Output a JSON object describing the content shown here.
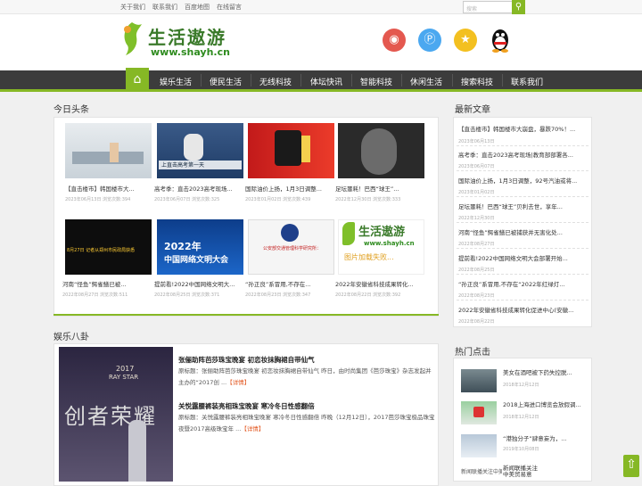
{
  "topbar": {
    "links": [
      "关于我们",
      "联系我们",
      "百度地图",
      "在线留言"
    ],
    "search_placeholder": "搜索"
  },
  "logo": {
    "title": "生活遨游",
    "url": "www.shayh.cn"
  },
  "nav": {
    "items": [
      "娱乐生活",
      "便民生活",
      "无线科技",
      "体坛快讯",
      "智能科技",
      "休闲生活",
      "搜索科技",
      "联系我们"
    ]
  },
  "headlines": {
    "title": "今日头条",
    "cards": [
      {
        "title": "【直击楼市】韩国楼市大...",
        "date": "2023年06月13日",
        "views": "浏览次数:394"
      },
      {
        "title": "高考季：直击2023高考现场...",
        "date": "2023年06月07日",
        "views": "浏览次数:325"
      },
      {
        "title": "国际油价上扬，1月3日调整...",
        "date": "2023年01月02日",
        "views": "浏览次数:439"
      },
      {
        "title": "足坛噩耗！巴西“球王”...",
        "date": "2022年12月30日",
        "views": "浏览次数:333"
      },
      {
        "title": "河南“怪鱼”鳄雀鳝已被...",
        "date": "2022年08月27日",
        "views": "浏览次数:511"
      },
      {
        "title": "提前看!2022中国网络文明大...",
        "date": "2022年08月25日",
        "views": "浏览次数:371"
      },
      {
        "title": "“孙正良”系冒用,不存在...",
        "date": "2022年08月23日",
        "views": "浏览次数:347"
      },
      {
        "title": "2022年安徽省科技成果转化...",
        "date": "2022年08月22日",
        "views": "浏览次数:392"
      }
    ],
    "img_texts": {
      "c2": "上直击高考第一天",
      "c6a": "2022年",
      "c6b": "中国网络文明大会",
      "c7": "公安部交通管理科学研究所：",
      "c5": "8月27日 记者从郑州市民政局获悉",
      "c8a": "生活遨游",
      "c8b": "www.shayh.cn",
      "c8c": "图片加载失败..."
    }
  },
  "latest": {
    "title": "最新文章",
    "items": [
      {
        "title": "【直击楼市】韩国楼市大崩盘，暴跌70%！...",
        "date": "2023年06月13日"
      },
      {
        "title": "高考季：直击2023高考现场|教育部部署各...",
        "date": "2023年06月07日"
      },
      {
        "title": "国际油价上扬，1月3日调整，92号汽油或将...",
        "date": "2023年01月02日"
      },
      {
        "title": "足坛噩耗！巴西“球王”贝利去世，享年...",
        "date": "2022年12月30日"
      },
      {
        "title": "河南“怪鱼”鳄雀鳝已被捕获并无害化处...",
        "date": "2022年08月27日"
      },
      {
        "title": "提前看!2022中国网络文明大会部署开始...",
        "date": "2022年08月25日"
      },
      {
        "title": "“孙正良”系冒用,不存在“2022年红绿灯...",
        "date": "2022年08月23日"
      },
      {
        "title": "2022年安徽省科技成果转化促进中心(安徽...",
        "date": "2022年08月22日"
      }
    ]
  },
  "entertainment": {
    "title": "娱乐八卦",
    "poster": {
      "line1": "2017",
      "line2": "RAY STAR",
      "big": "创者荣耀"
    },
    "articles": [
      {
        "title": "张俪助阵芭莎珠宝晚宴 初恋妆抹胸裙自带仙气",
        "text": "原标题：张俪助阵芭莎珠宝晚宴 初恋妆抹胸裙自带仙气 昨日，由时尚集团《芭莎珠宝》杂志发起并主办的“2017创 ...",
        "more": "【详情】"
      },
      {
        "title": "关悦露腰裤装亮相珠宝晚宴 寒冷冬日性感翻倍",
        "text": "原标题：关悦露腰裤装亮相珠宝晚宴 寒冷冬日性感翻倍 昨晚（12月12日），2017芭莎珠宝极品珠宝夜暨2017高级珠宝年 ...",
        "more": "【详情】"
      }
    ]
  },
  "hot": {
    "title": "热门点击",
    "items": [
      {
        "title": "美女在酒吧被下药失控脱...",
        "date": "2018年12月12日"
      },
      {
        "title": "2018上海进口博览会放假调...",
        "date": "2018年12月12日"
      },
      {
        "title": "“港独分子”肆意妄为，...",
        "date": "2019年10月08日"
      },
      {
        "title": "新闻联播关注中美贸易意",
        "date": ""
      }
    ],
    "thumb_alt": "新闻联播关注中美贸易意"
  },
  "colors": {
    "accent": "#86b825",
    "nav_bg": "#3c3c3c",
    "weibo": "#e4584f",
    "pinterest": "#4ba8f0",
    "star": "#f3c020"
  }
}
